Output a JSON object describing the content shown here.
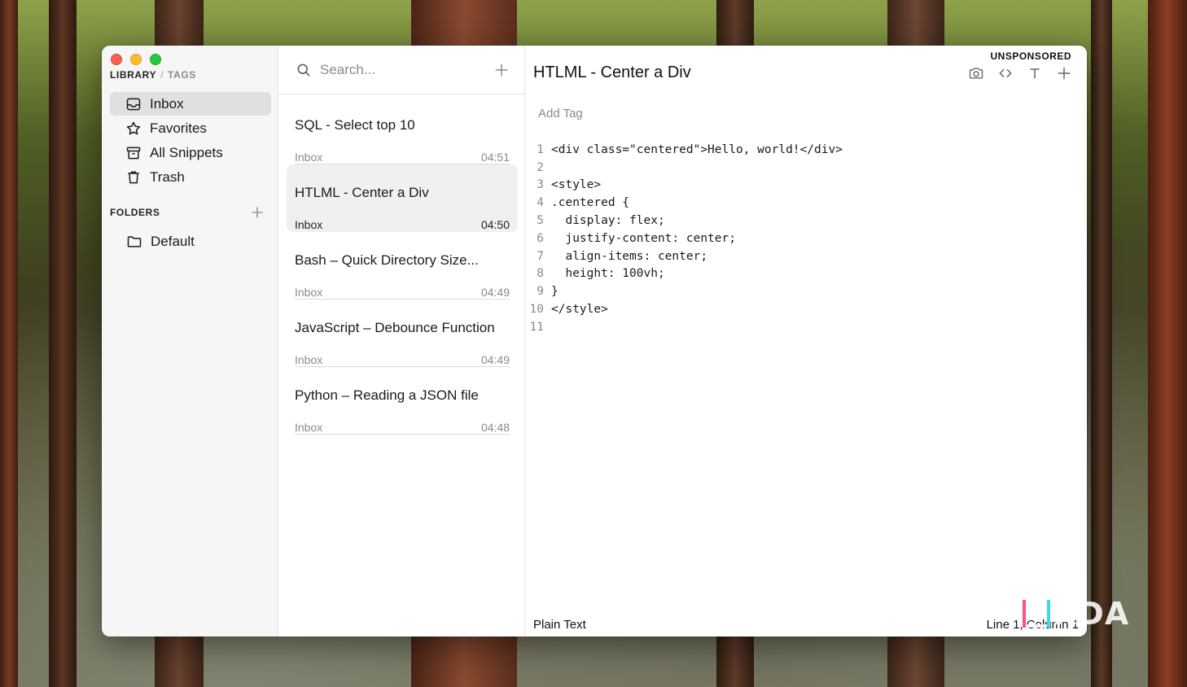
{
  "sidebar": {
    "tabs": {
      "library": "LIBRARY",
      "separator": "/",
      "tags": "TAGS"
    },
    "items": [
      {
        "label": "Inbox",
        "icon": "inbox-icon",
        "active": true
      },
      {
        "label": "Favorites",
        "icon": "star-icon"
      },
      {
        "label": "All Snippets",
        "icon": "archive-icon"
      },
      {
        "label": "Trash",
        "icon": "trash-icon"
      }
    ],
    "folders_heading": "FOLDERS",
    "folders": [
      {
        "label": "Default",
        "icon": "folder-icon"
      }
    ]
  },
  "list": {
    "search_placeholder": "Search...",
    "snippets": [
      {
        "title": "SQL - Select top 10",
        "folder": "Inbox",
        "time": "04:51"
      },
      {
        "title": "HTLML - Center a Div",
        "folder": "Inbox",
        "time": "04:50",
        "selected": true
      },
      {
        "title": "Bash – Quick Directory Size...",
        "folder": "Inbox",
        "time": "04:49"
      },
      {
        "title": "JavaScript – Debounce Function",
        "folder": "Inbox",
        "time": "04:49"
      },
      {
        "title": "Python – Reading a JSON file",
        "folder": "Inbox",
        "time": "04:48"
      }
    ]
  },
  "editor": {
    "badge": "UNSPONSORED",
    "title": "HTLML - Center a Div",
    "add_tag": "Add Tag",
    "code_lines": [
      "<div class=\"centered\">Hello, world!</div>",
      "",
      "<style>",
      ".centered {",
      "  display: flex;",
      "  justify-content: center;",
      "  align-items: center;",
      "  height: 100vh;",
      "}",
      "</style>",
      ""
    ],
    "language": "Plain Text",
    "cursor": "Line 1, Column 1"
  },
  "watermark": "XDA",
  "colors": {
    "close": "#fe5f57",
    "minimize": "#febc2e",
    "zoom": "#28c840",
    "selected_bg": "#e0e0e0"
  }
}
